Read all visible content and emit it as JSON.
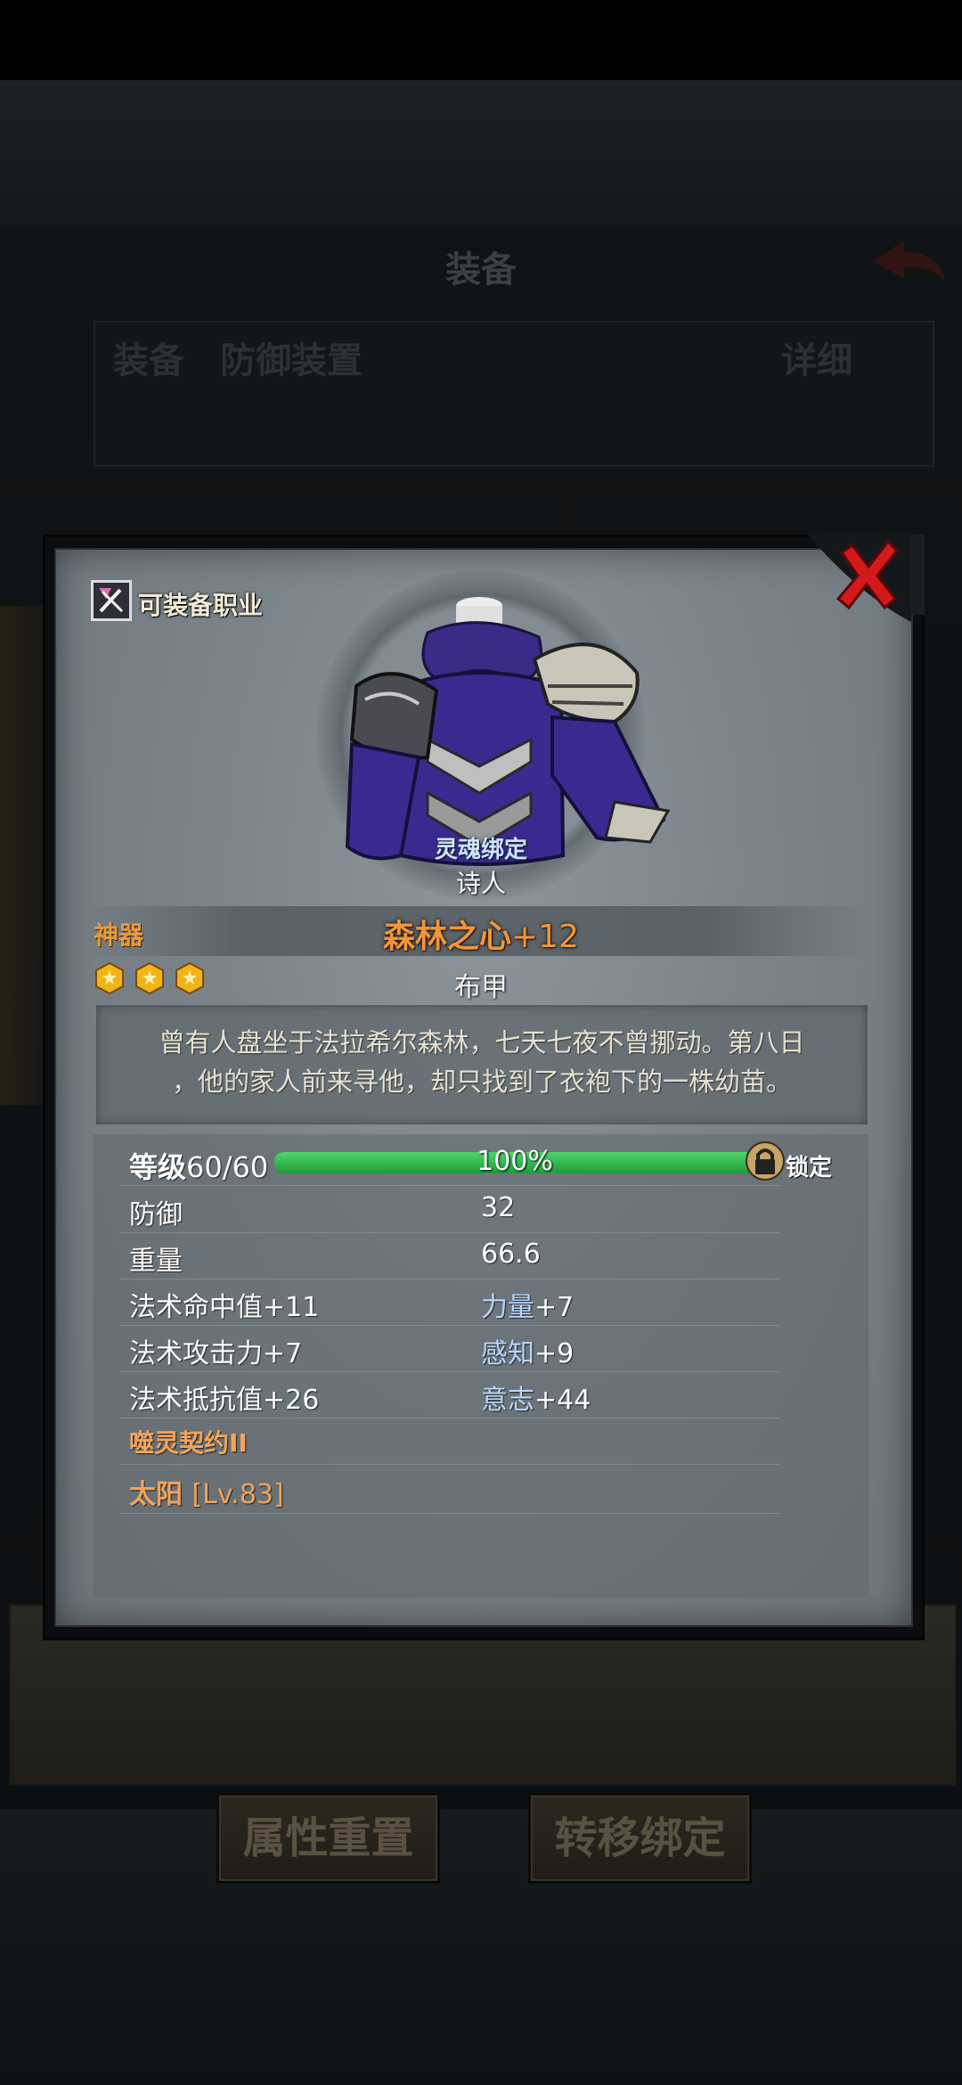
{
  "background": {
    "title": "装备",
    "row_left": "装备",
    "row_mid": "防御装置",
    "row_right": "详细",
    "buttons": [
      "属性重置",
      "转移绑定"
    ]
  },
  "modal": {
    "job_label": "可装备职业",
    "soulbound": "灵魂绑定",
    "class_name": "诗人",
    "rarity": "神器",
    "item_name": "森林之心",
    "item_plus": "+12",
    "star_count": 3,
    "item_type": "布甲",
    "description": [
      "曾有人盘坐于法拉希尔森林，七天七夜不曾挪动。第八日",
      "，他的家人前来寻他，却只找到了衣袍下的一株幼苗。"
    ],
    "level": {
      "label": "等级",
      "value": "60/60",
      "progress": 1.0,
      "progress_text": "100%",
      "lock_label": "锁定"
    },
    "stats": {
      "defense_label": "防御",
      "defense_value": "32",
      "weight_label": "重量",
      "weight_value": "66.6",
      "left": [
        {
          "label": "法术命中值",
          "value": "+11"
        },
        {
          "label": "法术攻击力",
          "value": "+7"
        },
        {
          "label": "法术抵抗值",
          "value": "+26"
        }
      ],
      "right": [
        {
          "label": "力量",
          "value": "+7"
        },
        {
          "label": "感知",
          "value": "+9"
        },
        {
          "label": "意志",
          "value": "+44"
        }
      ],
      "special": "噬灵契约II",
      "rune_name": "太阳",
      "rune_level": "[Lv.83]"
    }
  },
  "colors": {
    "orange_text": "#f2953a",
    "progress_green": "#2fbf4f",
    "close_red": "#d21a1a"
  }
}
